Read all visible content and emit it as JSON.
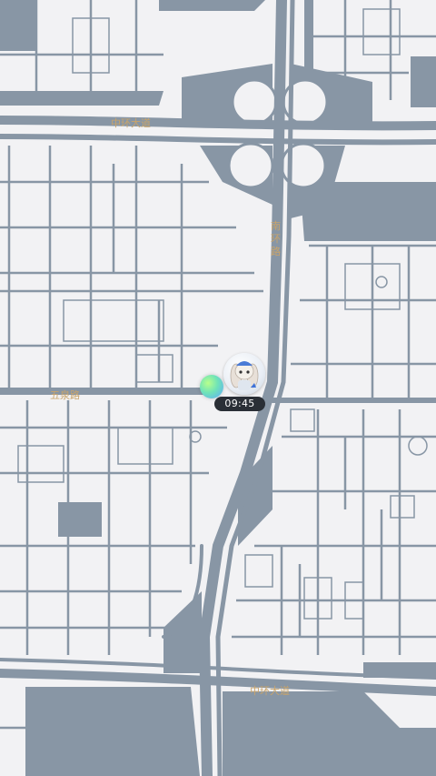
{
  "map": {
    "roads": {
      "top_avenue": "中环大道",
      "left_road": "五泉路",
      "vertical_road": "南\n环\n路",
      "bottom_avenue": "中环大道"
    },
    "colors": {
      "land": "#f2f2f4",
      "road": "#8896a5",
      "block": "#8896a5",
      "label": "#c9a46a"
    }
  },
  "marker": {
    "time": "09:45",
    "avatar_icon": "bunny-avatar-icon",
    "location_icon": "location-dot-icon"
  }
}
